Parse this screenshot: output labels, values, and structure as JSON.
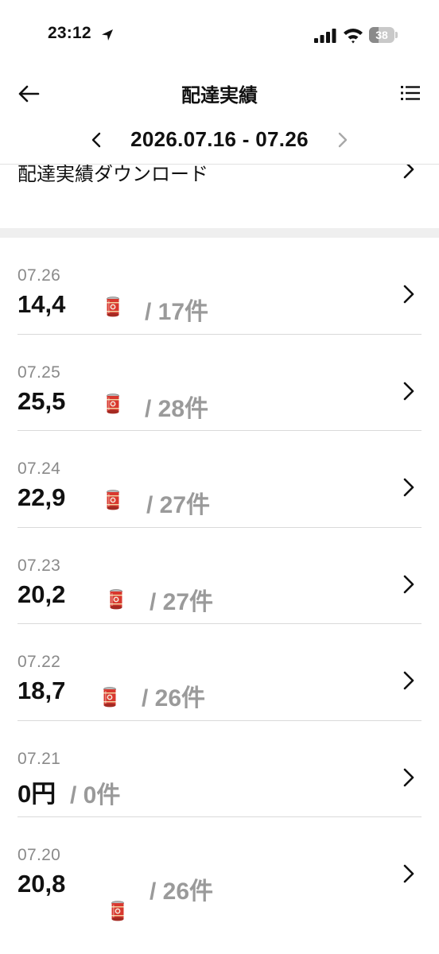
{
  "status_bar": {
    "time": "23:12",
    "battery": "38",
    "battery_level": 0.38
  },
  "header": {
    "title": "配達実績"
  },
  "date_nav": {
    "range": "2026.07.16 - 07.26"
  },
  "download": {
    "label": "配達実績ダウンロード"
  },
  "records": [
    {
      "date": "07.26",
      "amount": "14,4",
      "count": "/ 17件"
    },
    {
      "date": "07.25",
      "amount": "25,5",
      "count": "/ 28件"
    },
    {
      "date": "07.24",
      "amount": "22,9",
      "count": "/ 27件"
    },
    {
      "date": "07.23",
      "amount": "20,2",
      "count": "/ 27件"
    },
    {
      "date": "07.22",
      "amount": "18,7",
      "count": "/ 26件"
    },
    {
      "date": "07.21",
      "amount": "0円",
      "count": "/ 0件"
    },
    {
      "date": "07.20",
      "amount": "20,8",
      "count": "/ 26件"
    }
  ],
  "colors": {
    "amount_text": "#111111",
    "count_text": "#9a9a9a",
    "date_text": "#8a8a8a",
    "can_red": "#d8382e"
  },
  "icons": {
    "back": "arrow-left-icon",
    "menu": "list-icon",
    "prev": "chevron-left-icon",
    "next": "chevron-right-icon",
    "row": "chevron-right-icon",
    "sticker": "tomato-can-icon"
  }
}
